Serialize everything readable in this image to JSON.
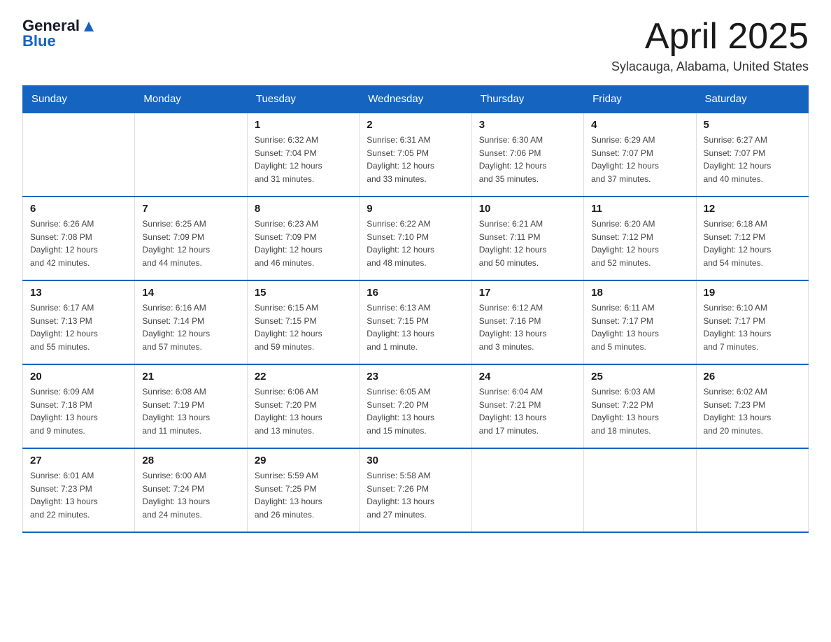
{
  "header": {
    "logo_general": "General",
    "logo_blue": "Blue",
    "month_title": "April 2025",
    "location": "Sylacauga, Alabama, United States"
  },
  "days_of_week": [
    "Sunday",
    "Monday",
    "Tuesday",
    "Wednesday",
    "Thursday",
    "Friday",
    "Saturday"
  ],
  "weeks": [
    [
      {
        "day": "",
        "info": ""
      },
      {
        "day": "",
        "info": ""
      },
      {
        "day": "1",
        "info": "Sunrise: 6:32 AM\nSunset: 7:04 PM\nDaylight: 12 hours\nand 31 minutes."
      },
      {
        "day": "2",
        "info": "Sunrise: 6:31 AM\nSunset: 7:05 PM\nDaylight: 12 hours\nand 33 minutes."
      },
      {
        "day": "3",
        "info": "Sunrise: 6:30 AM\nSunset: 7:06 PM\nDaylight: 12 hours\nand 35 minutes."
      },
      {
        "day": "4",
        "info": "Sunrise: 6:29 AM\nSunset: 7:07 PM\nDaylight: 12 hours\nand 37 minutes."
      },
      {
        "day": "5",
        "info": "Sunrise: 6:27 AM\nSunset: 7:07 PM\nDaylight: 12 hours\nand 40 minutes."
      }
    ],
    [
      {
        "day": "6",
        "info": "Sunrise: 6:26 AM\nSunset: 7:08 PM\nDaylight: 12 hours\nand 42 minutes."
      },
      {
        "day": "7",
        "info": "Sunrise: 6:25 AM\nSunset: 7:09 PM\nDaylight: 12 hours\nand 44 minutes."
      },
      {
        "day": "8",
        "info": "Sunrise: 6:23 AM\nSunset: 7:09 PM\nDaylight: 12 hours\nand 46 minutes."
      },
      {
        "day": "9",
        "info": "Sunrise: 6:22 AM\nSunset: 7:10 PM\nDaylight: 12 hours\nand 48 minutes."
      },
      {
        "day": "10",
        "info": "Sunrise: 6:21 AM\nSunset: 7:11 PM\nDaylight: 12 hours\nand 50 minutes."
      },
      {
        "day": "11",
        "info": "Sunrise: 6:20 AM\nSunset: 7:12 PM\nDaylight: 12 hours\nand 52 minutes."
      },
      {
        "day": "12",
        "info": "Sunrise: 6:18 AM\nSunset: 7:12 PM\nDaylight: 12 hours\nand 54 minutes."
      }
    ],
    [
      {
        "day": "13",
        "info": "Sunrise: 6:17 AM\nSunset: 7:13 PM\nDaylight: 12 hours\nand 55 minutes."
      },
      {
        "day": "14",
        "info": "Sunrise: 6:16 AM\nSunset: 7:14 PM\nDaylight: 12 hours\nand 57 minutes."
      },
      {
        "day": "15",
        "info": "Sunrise: 6:15 AM\nSunset: 7:15 PM\nDaylight: 12 hours\nand 59 minutes."
      },
      {
        "day": "16",
        "info": "Sunrise: 6:13 AM\nSunset: 7:15 PM\nDaylight: 13 hours\nand 1 minute."
      },
      {
        "day": "17",
        "info": "Sunrise: 6:12 AM\nSunset: 7:16 PM\nDaylight: 13 hours\nand 3 minutes."
      },
      {
        "day": "18",
        "info": "Sunrise: 6:11 AM\nSunset: 7:17 PM\nDaylight: 13 hours\nand 5 minutes."
      },
      {
        "day": "19",
        "info": "Sunrise: 6:10 AM\nSunset: 7:17 PM\nDaylight: 13 hours\nand 7 minutes."
      }
    ],
    [
      {
        "day": "20",
        "info": "Sunrise: 6:09 AM\nSunset: 7:18 PM\nDaylight: 13 hours\nand 9 minutes."
      },
      {
        "day": "21",
        "info": "Sunrise: 6:08 AM\nSunset: 7:19 PM\nDaylight: 13 hours\nand 11 minutes."
      },
      {
        "day": "22",
        "info": "Sunrise: 6:06 AM\nSunset: 7:20 PM\nDaylight: 13 hours\nand 13 minutes."
      },
      {
        "day": "23",
        "info": "Sunrise: 6:05 AM\nSunset: 7:20 PM\nDaylight: 13 hours\nand 15 minutes."
      },
      {
        "day": "24",
        "info": "Sunrise: 6:04 AM\nSunset: 7:21 PM\nDaylight: 13 hours\nand 17 minutes."
      },
      {
        "day": "25",
        "info": "Sunrise: 6:03 AM\nSunset: 7:22 PM\nDaylight: 13 hours\nand 18 minutes."
      },
      {
        "day": "26",
        "info": "Sunrise: 6:02 AM\nSunset: 7:23 PM\nDaylight: 13 hours\nand 20 minutes."
      }
    ],
    [
      {
        "day": "27",
        "info": "Sunrise: 6:01 AM\nSunset: 7:23 PM\nDaylight: 13 hours\nand 22 minutes."
      },
      {
        "day": "28",
        "info": "Sunrise: 6:00 AM\nSunset: 7:24 PM\nDaylight: 13 hours\nand 24 minutes."
      },
      {
        "day": "29",
        "info": "Sunrise: 5:59 AM\nSunset: 7:25 PM\nDaylight: 13 hours\nand 26 minutes."
      },
      {
        "day": "30",
        "info": "Sunrise: 5:58 AM\nSunset: 7:26 PM\nDaylight: 13 hours\nand 27 minutes."
      },
      {
        "day": "",
        "info": ""
      },
      {
        "day": "",
        "info": ""
      },
      {
        "day": "",
        "info": ""
      }
    ]
  ]
}
